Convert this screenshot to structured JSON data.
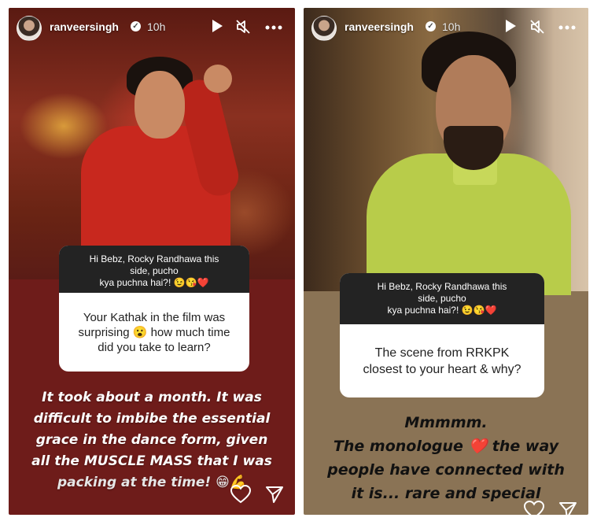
{
  "stories": [
    {
      "username": "ranveersingh",
      "time": "10h",
      "sticker_prompt": "Hi Bebz, Rocky Randhawa this side, pucho kya puchna hai?! 😉😘❤️",
      "prompt_line1": "Hi Bebz, Rocky Randhawa this",
      "prompt_line2": "side, pucho",
      "prompt_line3": "kya puchna hai?! 😉😘❤️",
      "question_line1": "Your Kathak in the film was",
      "question_line2": "surprising 😮 how much time",
      "question_line3": "did you take to learn?",
      "answer_lines": [
        "It took about a month. It was",
        "difficult to imbibe the essential",
        "grace in the dance form, given",
        "all the MUSCLE MASS that I was",
        "packing at the time! 😁💪"
      ]
    },
    {
      "username": "ranveersingh",
      "time": "10h",
      "prompt_line1": "Hi Bebz, Rocky Randhawa this",
      "prompt_line2": "side, pucho",
      "prompt_line3": "kya puchna hai?! 😉😘❤️",
      "question_line1": "The scene from RRKPK",
      "question_line2": "closest to your heart & why?",
      "answer_lines": [
        "Mmmmm.",
        "The monologue ❤️ the way",
        "people have connected with",
        "it is... rare and special"
      ]
    }
  ],
  "icons": {
    "play": "play-icon",
    "mute": "mute-icon",
    "more": "more-options-icon",
    "like": "heart-icon",
    "share": "send-icon",
    "verified": "verified-badge-icon"
  },
  "colors": {
    "left_bg": "#6e1c1a",
    "right_bg": "#8a7355",
    "sticker_header": "#232323"
  }
}
